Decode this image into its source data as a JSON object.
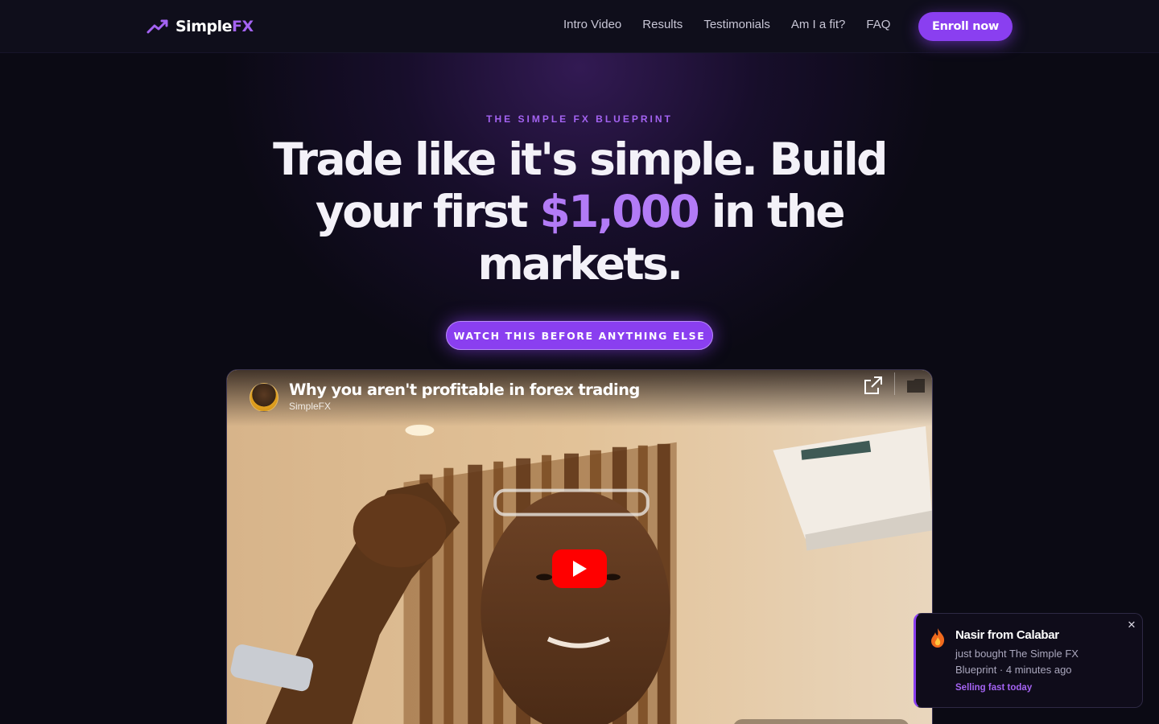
{
  "nav": {
    "brand_a": "Simple",
    "brand_b": "FX",
    "links": [
      "Intro Video",
      "Results",
      "Testimonials",
      "Am I a fit?",
      "FAQ"
    ],
    "cta": "Enroll now",
    "logo_icon": "trend-up-icon"
  },
  "hero": {
    "eyebrow": "THE SIMPLE FX BLUEPRINT",
    "headline_before": "Trade like it's simple. Build your first ",
    "headline_accent": "$1,000",
    "headline_after": " in the markets.",
    "cta": "WATCH THIS BEFORE ANYTHING ELSE"
  },
  "video": {
    "title": "Why you aren't profitable in forex trading",
    "channel": "SimpleFX",
    "icons": [
      "share-icon",
      "folder-icon",
      "play-icon"
    ]
  },
  "toast": {
    "name": "Nasir from Calabar",
    "message": "just bought The Simple FX Blueprint · 4 minutes ago",
    "tag": "Selling fast today",
    "close": "✕",
    "icon": "fire-icon"
  },
  "colors": {
    "background": "#0b0a14",
    "accent": "#8a3ff0",
    "accent_text": "#a463f2",
    "youtube_red": "#ff0000"
  }
}
